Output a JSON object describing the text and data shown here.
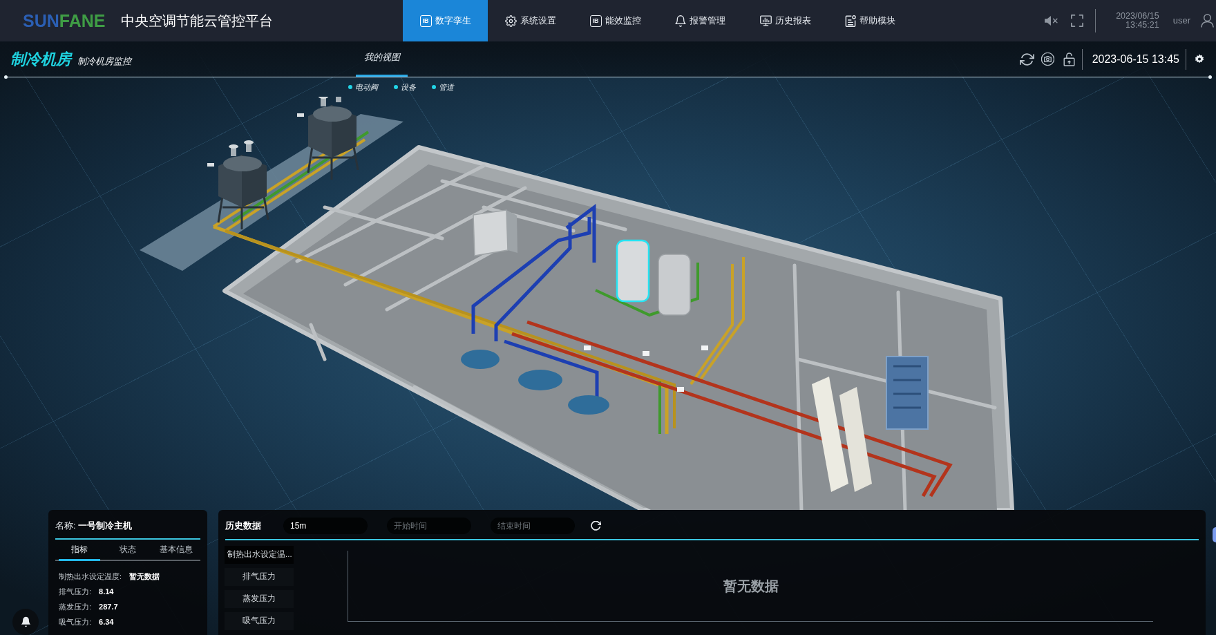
{
  "header": {
    "logo": [
      {
        "text": "SUN",
        "color": "#2b5fb4"
      },
      {
        "text": "FANE",
        "color": "#3f9d45"
      }
    ],
    "title": "中央空调节能云管控平台",
    "nav": [
      {
        "label": "数字孪生",
        "kind": "badge",
        "badge": "IB",
        "selected": true
      },
      {
        "label": "系统设置",
        "kind": "gear",
        "selected": false
      },
      {
        "label": "能效监控",
        "kind": "badge",
        "badge": "IB",
        "selected": false
      },
      {
        "label": "报警管理",
        "kind": "bell",
        "selected": false
      },
      {
        "label": "历史报表",
        "kind": "chart",
        "selected": false
      },
      {
        "label": "帮助模块",
        "kind": "note",
        "selected": false
      }
    ],
    "muted": true,
    "date": "2023/06/15",
    "time": "13:45:21",
    "user": "user"
  },
  "page_bar": {
    "title": "制冷机房",
    "subtitle": "制冷机房监控",
    "view_tabs": [
      {
        "label": "我的视图",
        "selected": true
      }
    ],
    "locked": false,
    "datetime": "2023-06-15 13:45"
  },
  "legend": [
    {
      "label": "电动阀"
    },
    {
      "label": "设备"
    },
    {
      "label": "管道"
    }
  ],
  "device_panel": {
    "title": "名称: **一号制冷主机**",
    "tabs": [
      {
        "label": "指标",
        "selected": true
      },
      {
        "label": "状态",
        "selected": false
      },
      {
        "label": "基本信息",
        "selected": false
      }
    ],
    "metrics": [
      {
        "label": "制热出水设定温度:",
        "value": "暂无数据"
      },
      {
        "label": "排气压力:",
        "value": "8.14"
      },
      {
        "label": "蒸发压力:",
        "value": "287.7"
      },
      {
        "label": "吸气压力:",
        "value": "6.34"
      }
    ]
  },
  "history_panel": {
    "title": "历史数据",
    "interval": "15m",
    "start_placeholder": "开始时间",
    "end_placeholder": "结束时间",
    "series": [
      {
        "label": "制热出水设定温...",
        "selected": true
      },
      {
        "label": "排气压力",
        "selected": false
      },
      {
        "label": "蒸发压力",
        "selected": false
      },
      {
        "label": "吸气压力",
        "selected": false
      }
    ],
    "empty_text": "暂无数据"
  }
}
